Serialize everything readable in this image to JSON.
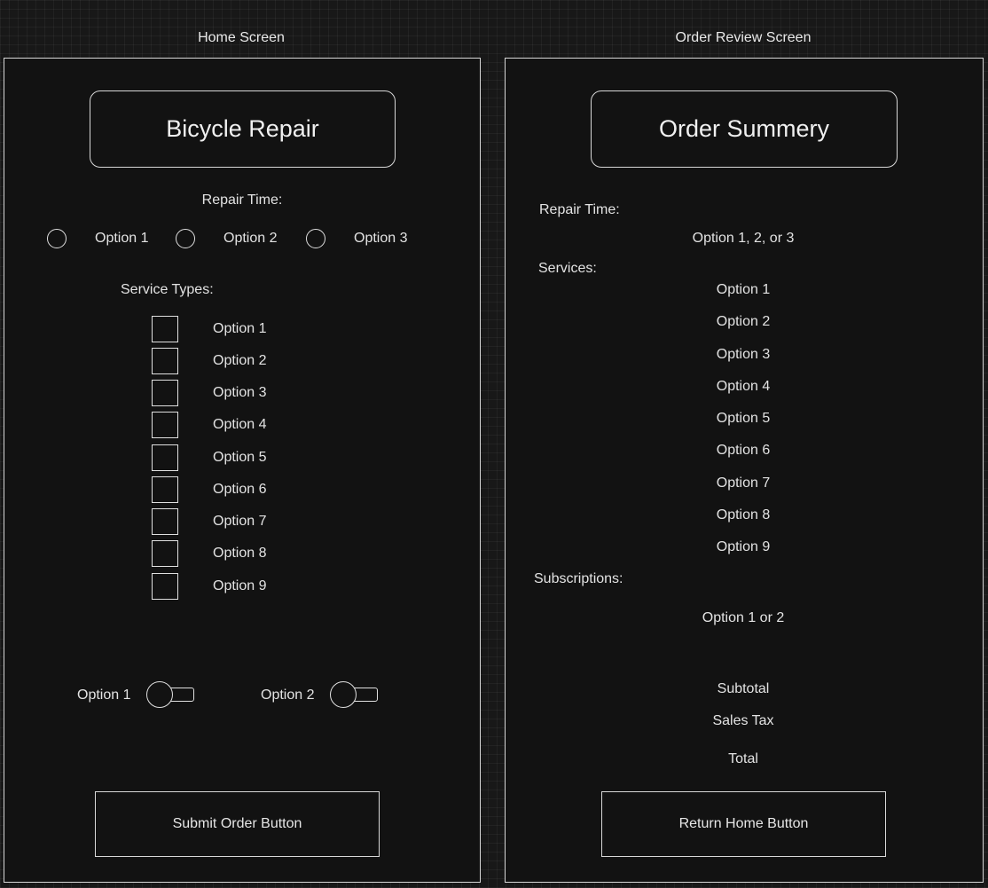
{
  "home": {
    "caption": "Home Screen",
    "title": "Bicycle Repair",
    "repair_time_label": "Repair Time:",
    "radio_options": [
      "Option 1",
      "Option 2",
      "Option 3"
    ],
    "service_types_label": "Service Types:",
    "services": [
      "Option 1",
      "Option 2",
      "Option 3",
      "Option 4",
      "Option 5",
      "Option 6",
      "Option 7",
      "Option 8",
      "Option 9"
    ],
    "toggles": [
      "Option 1",
      "Option 2"
    ],
    "submit_label": "Submit Order Button"
  },
  "review": {
    "caption": "Order Review Screen",
    "title": "Order Summery",
    "repair_time_label": "Repair Time:",
    "repair_time_value": "Option 1, 2, or 3",
    "services_label": "Services:",
    "services": [
      "Option 1",
      "Option 2",
      "Option 3",
      "Option 4",
      "Option 5",
      "Option 6",
      "Option 7",
      "Option 8",
      "Option 9"
    ],
    "subscriptions_label": "Subscriptions:",
    "subscriptions_value": "Option 1 or 2",
    "subtotal_label": "Subtotal",
    "sales_tax_label": "Sales Tax",
    "total_label": "Total",
    "return_label": "Return Home Button"
  }
}
